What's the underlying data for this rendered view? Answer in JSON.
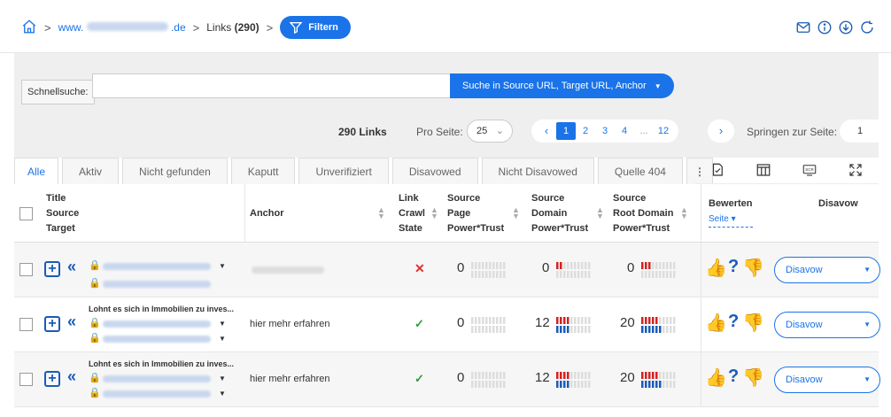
{
  "breadcrumb": {
    "prefix": "www.",
    "suffix": ".de",
    "links_label": "Links",
    "links_count": "(290)",
    "filter_label": "Filtern"
  },
  "search": {
    "label": "Schnellsuche:",
    "value": "",
    "button_label": "Suche in Source URL, Target URL, Anchor"
  },
  "pagination": {
    "count_label": "290 Links",
    "per_page_label": "Pro Seite:",
    "per_page_value": "25",
    "pages": [
      "1",
      "2",
      "3",
      "4",
      "...",
      "12"
    ],
    "current_page": "1",
    "jump_label": "Springen zur Seite:",
    "jump_value": "1"
  },
  "tabs": [
    {
      "label": "Alle",
      "active": true
    },
    {
      "label": "Aktiv"
    },
    {
      "label": "Nicht gefunden"
    },
    {
      "label": "Kaputt"
    },
    {
      "label": "Unverifiziert"
    },
    {
      "label": "Disavowed"
    },
    {
      "label": "Nicht Disavowed"
    },
    {
      "label": "Quelle 404"
    }
  ],
  "table": {
    "headers": {
      "title_line1": "Title",
      "title_line2": "Source",
      "title_line3": "Target",
      "anchor": "Anchor",
      "crawl_line1": "Link",
      "crawl_line2": "Crawl",
      "crawl_line3": "State",
      "sp_line1": "Source",
      "sp_line2": "Page",
      "sp_line3": "Power*Trust",
      "sd_line1": "Source",
      "sd_line2": "Domain",
      "sd_line3": "Power*Trust",
      "srd_line1": "Source",
      "srd_line2": "Root Domain",
      "srd_line3": "Power*Trust",
      "rate": "Bewerten",
      "rate_sub": "Seite",
      "disavow": "Disavow"
    },
    "rows": [
      {
        "title": "",
        "anchor": "",
        "crawl_state": "error",
        "source_page": "0",
        "source_domain": "0",
        "source_root_domain": "0",
        "disavow": "Disavow"
      },
      {
        "title": "Lohnt es sich in Immobilien zu inves...",
        "anchor": "hier mehr erfahren",
        "crawl_state": "ok",
        "source_page": "0",
        "source_domain": "12",
        "source_root_domain": "20",
        "disavow": "Disavow"
      },
      {
        "title": "Lohnt es sich in Immobilien zu inves...",
        "anchor": "hier mehr erfahren",
        "crawl_state": "ok",
        "source_page": "0",
        "source_domain": "12",
        "source_root_domain": "20",
        "disavow": "Disavow"
      }
    ]
  },
  "colors": {
    "accent": "#1a73e8",
    "ok": "#2a9d3a",
    "error": "#e03030"
  }
}
